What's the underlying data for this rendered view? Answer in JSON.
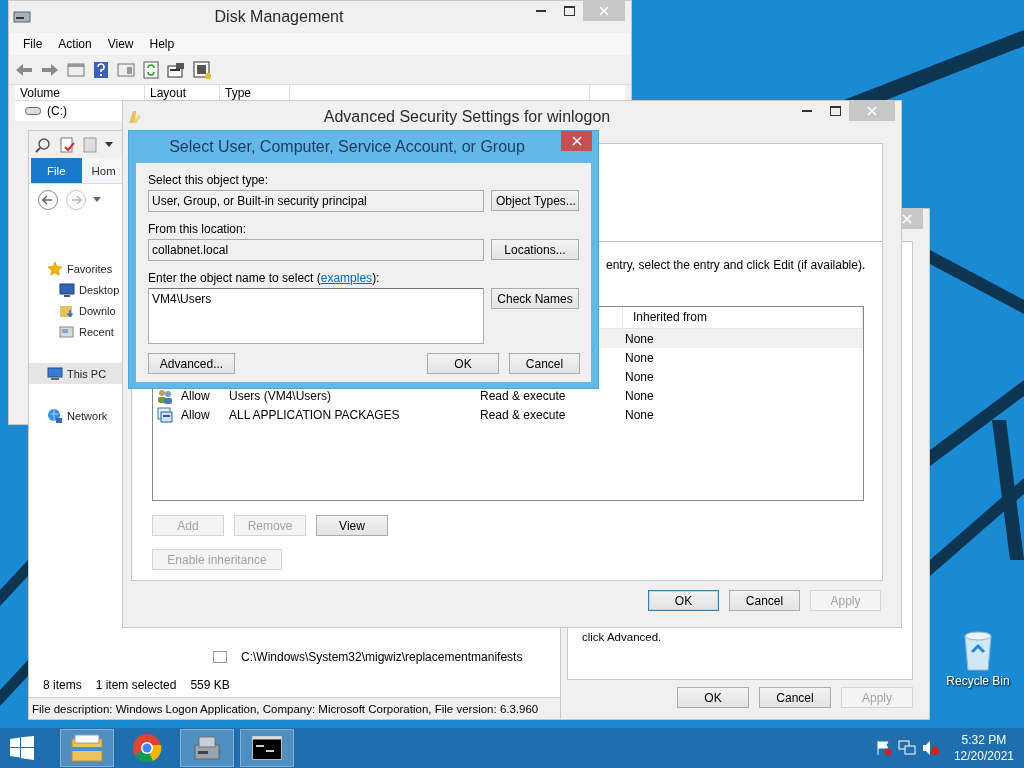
{
  "desktop": {
    "recycle_bin": {
      "label": "Recycle Bin"
    }
  },
  "disk_management": {
    "title": "Disk Management",
    "menu": [
      "File",
      "Action",
      "View",
      "Help"
    ],
    "columns": [
      "Volume",
      "Layout",
      "Type"
    ],
    "volumes": [
      "(C:)"
    ]
  },
  "explorer": {
    "ribbon_tabs": [
      {
        "label": "File",
        "selected": true
      },
      {
        "label": "Hom",
        "selected": false
      }
    ],
    "navigation": [
      {
        "label": "Favorites",
        "kind": "favorites",
        "selected": false,
        "children": [
          {
            "label": "Desktop",
            "kind": "desktop",
            "selected": false
          },
          {
            "label": "Downlo",
            "kind": "downloads",
            "selected": false
          },
          {
            "label": "Recent",
            "kind": "recent",
            "selected": false
          }
        ]
      },
      {
        "label": "This PC",
        "kind": "pc",
        "selected": true
      },
      {
        "label": "Network",
        "kind": "network",
        "selected": false
      }
    ],
    "file_path": "C:\\Windows\\System32\\migwiz\\replacementmanifests",
    "status": {
      "items": "8 items",
      "selection": "1 item selected",
      "size": "559 KB"
    },
    "details_bar": "File description: Windows Logon Application, Company: Microsoft Corporation, File version: 6.3.960"
  },
  "properties": {
    "note": "click Advanced.",
    "buttons": [
      {
        "label": "OK",
        "disabled": false
      },
      {
        "label": "Cancel",
        "disabled": false
      },
      {
        "label": "Apply",
        "disabled": true
      }
    ]
  },
  "advanced_security": {
    "title": "Advanced Security Settings for winlogon",
    "instruction": "entry, select the entry and click Edit (if available).",
    "inherited_header": "Inherited from",
    "entries": [
      {
        "inherited": "None",
        "selected": true
      },
      {
        "inherited": "None",
        "selected": false
      },
      {
        "inherited": "None",
        "selected": false
      },
      {
        "kind": "group",
        "type": "Allow",
        "principal": "Users (VM4\\Users)",
        "access": "Read & execute",
        "inherited": "None",
        "selected": false
      },
      {
        "kind": "package",
        "type": "Allow",
        "principal": "ALL APPLICATION PACKAGES",
        "access": "Read & execute",
        "inherited": "None",
        "selected": false
      }
    ],
    "entry_buttons": [
      {
        "label": "Add",
        "disabled": true
      },
      {
        "label": "Remove",
        "disabled": true
      },
      {
        "label": "View",
        "disabled": false
      }
    ],
    "inheritance_button": {
      "label": "Enable inheritance",
      "disabled": true
    },
    "footer_buttons": [
      {
        "label": "OK",
        "disabled": false,
        "default": true
      },
      {
        "label": "Cancel",
        "disabled": false,
        "default": false
      },
      {
        "label": "Apply",
        "disabled": true,
        "default": false
      }
    ]
  },
  "select_dialog": {
    "title": "Select User, Computer, Service Account, or Group",
    "object_type_label": "Select this object type:",
    "object_type": "User, Group, or Built-in security principal",
    "object_types_button": "Object Types...",
    "location_label": "From this location:",
    "location": "collabnet.local",
    "locations_button": "Locations...",
    "name_label_before": "Enter the object name to select (",
    "name_link": "examples",
    "name_label_after": "):",
    "name_value": "VM4\\Users",
    "check_names_button": "Check Names",
    "advanced_button": "Advanced...",
    "ok_button": "OK",
    "cancel_button": "Cancel"
  },
  "taskbar": {
    "apps": [
      {
        "kind": "explorer",
        "running": true
      },
      {
        "kind": "chrome",
        "running": false
      },
      {
        "kind": "disk",
        "running": true
      },
      {
        "kind": "console",
        "running": true
      }
    ],
    "time": "5:32 PM",
    "date": "12/20/2021"
  }
}
